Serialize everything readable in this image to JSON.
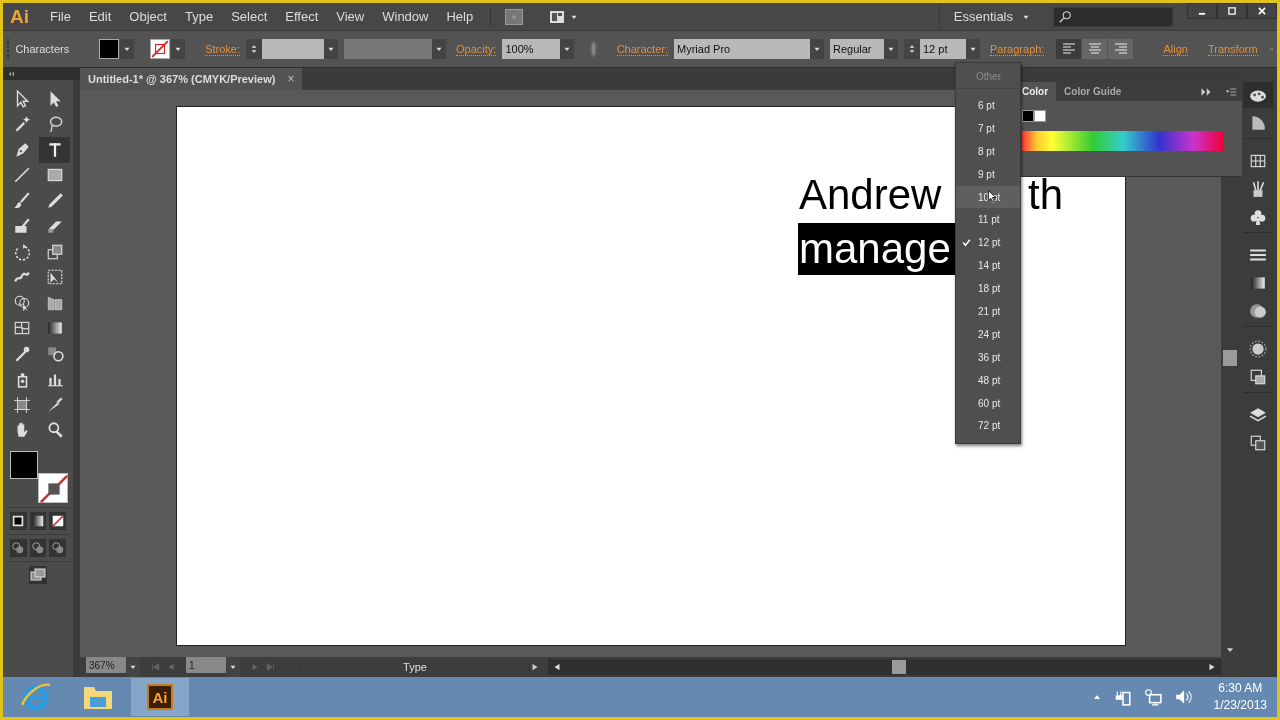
{
  "app_logo": "Ai",
  "menu": [
    "File",
    "Edit",
    "Object",
    "Type",
    "Select",
    "Effect",
    "View",
    "Window",
    "Help"
  ],
  "workspace": {
    "label": "Essentials"
  },
  "control_bar": {
    "selection_label": "Characters",
    "stroke_label": "Stroke:",
    "opacity_label": "Opacity:",
    "opacity": "100%",
    "character_label": "Character:",
    "font": "Myriad Pro",
    "style": "Regular",
    "size": "12 pt",
    "paragraph_label": "Paragraph:",
    "alignments": [
      {
        "kind": "left",
        "selected": true
      },
      {
        "kind": "center",
        "selected": false
      },
      {
        "kind": "right",
        "selected": false
      }
    ],
    "links": [
      "Align",
      "Transform"
    ]
  },
  "document_tab": {
    "title": "Untitled-1* @ 367% (CMYK/Preview)",
    "close": "×"
  },
  "tools": [
    {
      "kind": "selection",
      "selected": false
    },
    {
      "kind": "direct",
      "selected": false
    },
    {
      "kind": "wand",
      "selected": false
    },
    {
      "kind": "lasso",
      "selected": false
    },
    {
      "kind": "pen",
      "selected": false
    },
    {
      "kind": "type",
      "selected": true
    },
    {
      "kind": "line",
      "selected": false
    },
    {
      "kind": "rect",
      "selected": false
    },
    {
      "kind": "brush",
      "selected": false
    },
    {
      "kind": "pencil",
      "selected": false
    },
    {
      "kind": "blob",
      "selected": false
    },
    {
      "kind": "eraser",
      "selected": false
    },
    {
      "kind": "rotate",
      "selected": false
    },
    {
      "kind": "scale",
      "selected": false
    },
    {
      "kind": "warp",
      "selected": false
    },
    {
      "kind": "freetransform",
      "selected": false
    },
    {
      "kind": "shapebuilder",
      "selected": false
    },
    {
      "kind": "perspective",
      "selected": false
    },
    {
      "kind": "mesh",
      "selected": false
    },
    {
      "kind": "gradient",
      "selected": false
    },
    {
      "kind": "eyedropper",
      "selected": false
    },
    {
      "kind": "blend",
      "selected": false
    },
    {
      "kind": "sprayer",
      "selected": false
    },
    {
      "kind": "graph",
      "selected": false
    },
    {
      "kind": "artboard",
      "selected": false
    },
    {
      "kind": "slice",
      "selected": false
    },
    {
      "kind": "hand",
      "selected": false
    },
    {
      "kind": "zoom",
      "selected": false
    }
  ],
  "artboard_text": [
    {
      "segments": [
        {
          "text": "Andrew",
          "selected": false
        },
        {
          "text": "th",
          "selected": false
        }
      ]
    },
    {
      "segments": [
        {
          "text": "manage",
          "selected": true
        }
      ]
    }
  ],
  "size_menu": [
    {
      "label": "Other",
      "disabled": true,
      "checked": false,
      "highlighted": false
    },
    {
      "label": "6 pt",
      "disabled": false,
      "checked": false,
      "highlighted": false
    },
    {
      "label": "7 pt",
      "disabled": false,
      "checked": false,
      "highlighted": false
    },
    {
      "label": "8 pt",
      "disabled": false,
      "checked": false,
      "highlighted": false
    },
    {
      "label": "9 pt",
      "disabled": false,
      "checked": false,
      "highlighted": false
    },
    {
      "label": "10 pt",
      "disabled": false,
      "checked": false,
      "highlighted": true
    },
    {
      "label": "11 pt",
      "disabled": false,
      "checked": false,
      "highlighted": false
    },
    {
      "label": "12 pt",
      "disabled": false,
      "checked": true,
      "highlighted": false
    },
    {
      "label": "14 pt",
      "disabled": false,
      "checked": false,
      "highlighted": false
    },
    {
      "label": "18 pt",
      "disabled": false,
      "checked": false,
      "highlighted": false
    },
    {
      "label": "21 pt",
      "disabled": false,
      "checked": false,
      "highlighted": false
    },
    {
      "label": "24 pt",
      "disabled": false,
      "checked": false,
      "highlighted": false
    },
    {
      "label": "36 pt",
      "disabled": false,
      "checked": false,
      "highlighted": false
    },
    {
      "label": "48 pt",
      "disabled": false,
      "checked": false,
      "highlighted": false
    },
    {
      "label": "60 pt",
      "disabled": false,
      "checked": false,
      "highlighted": false
    },
    {
      "label": "72 pt",
      "disabled": false,
      "checked": false,
      "highlighted": false
    }
  ],
  "color_panel": {
    "tabs": [
      {
        "label": "Color",
        "selected": true
      },
      {
        "label": "Color Guide",
        "selected": false
      }
    ]
  },
  "status_bar": {
    "zoom": "367%",
    "artboard": "1",
    "tool": "Type"
  },
  "taskbar": {
    "apps": [
      {
        "kind": "browser",
        "active": false
      },
      {
        "kind": "folder",
        "active": false
      },
      {
        "kind": "illustrator",
        "label": "Ai",
        "active": true
      }
    ],
    "time": "6:30 AM",
    "date": "1/23/2013"
  }
}
